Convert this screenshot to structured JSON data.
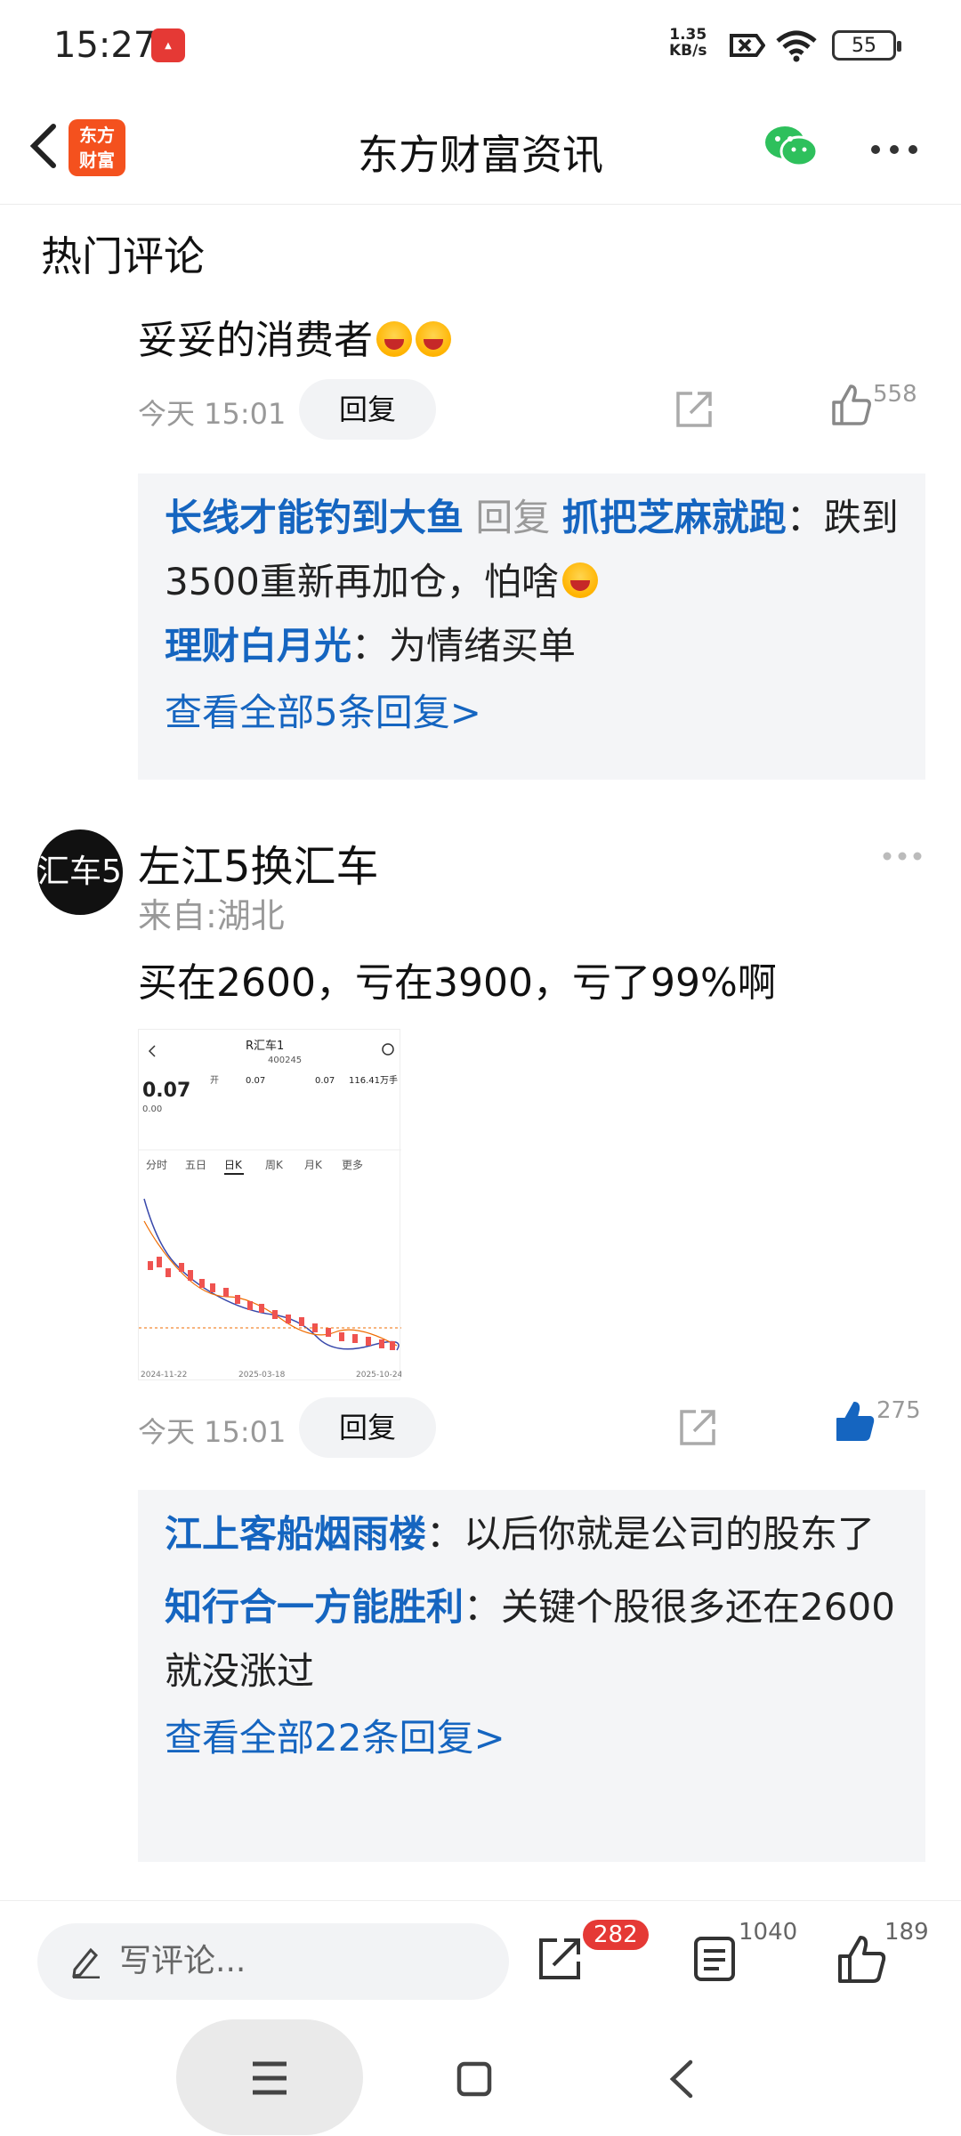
{
  "status_bar": {
    "time": "15:27",
    "net_speed": "1.35",
    "net_unit": "KB/s",
    "battery": "55"
  },
  "header": {
    "title": "东方财富资讯",
    "logo_text_line1": "东方",
    "logo_text_line2": "财富"
  },
  "section_title": "热门评论",
  "comment1": {
    "text": "妥妥的消费者",
    "time": "今天 15:01",
    "reply_label": "回复",
    "likes": "558",
    "replies": [
      {
        "author": "长线才能钓到大鱼",
        "reply_word": "回复",
        "target": "抓把芝麻就跑",
        "colon": "：",
        "text": "跌到3500重新再加仓，怕啥"
      },
      {
        "author": "理财白月光",
        "colon": "：",
        "text": "为情绪买单"
      }
    ],
    "view_all": "查看全部5条回复>"
  },
  "comment2": {
    "avatar_text": "汇车5",
    "username": "左江5换汇车",
    "location": "来自:湖北",
    "text": "买在2600，亏在3900，亏了99%啊",
    "time": "今天 15:01",
    "reply_label": "回复",
    "likes": "275",
    "replies": [
      {
        "author": "江上客船烟雨楼",
        "colon": "：",
        "text": "以后你就是公司的股东了"
      },
      {
        "author": "知行合一方能胜利",
        "colon": "：",
        "text": "关键个股很多还在2600就没涨过"
      }
    ],
    "view_all": "查看全部22条回复>"
  },
  "thumbnail": {
    "title": "R汇车1",
    "code": "400245",
    "price": "0.07",
    "change": "0.00",
    "open": "0.07",
    "high": "0.07",
    "vol": "116.41万手",
    "tabs": [
      "分时",
      "五日",
      "日K",
      "周K",
      "月K",
      "更多"
    ],
    "date_start": "2024-11-22",
    "date_mid": "2025-03-18",
    "date_end": "2025-10-24"
  },
  "bottom_bar": {
    "comment_placeholder": "写评论...",
    "share_count": "282",
    "comments_count": "1040",
    "likes_count": "189"
  },
  "colors": {
    "accent_blue": "#1565c0",
    "brand_orange": "#f4511e",
    "badge_red": "#e53935"
  }
}
